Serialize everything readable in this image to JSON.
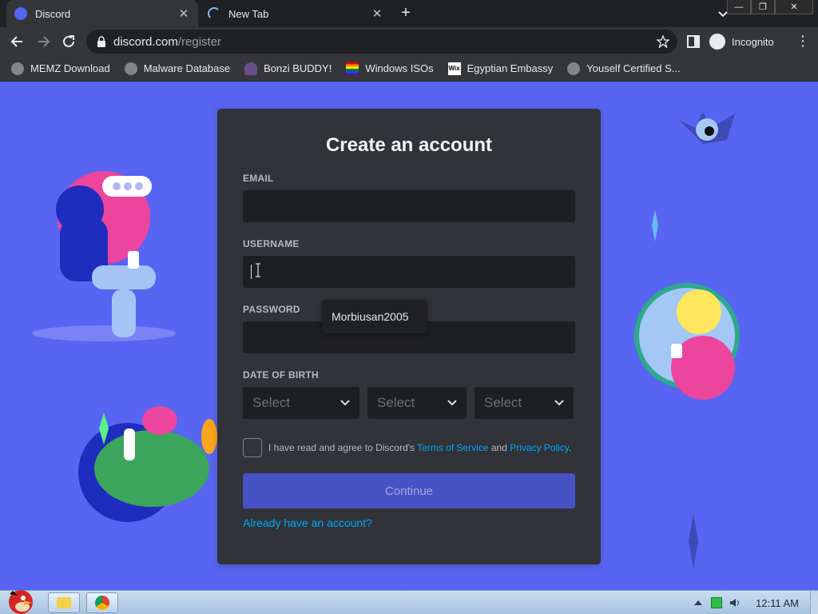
{
  "browser": {
    "tabs": [
      {
        "title": "Discord",
        "active": true
      },
      {
        "title": "New Tab",
        "active": false
      }
    ],
    "url_host": "discord.com",
    "url_path": "/register",
    "profile_label": "Incognito",
    "bookmarks": [
      {
        "label": "MEMZ Download",
        "icon": "globe-icon"
      },
      {
        "label": "Malware Database",
        "icon": "globe-icon"
      },
      {
        "label": "Bonzi BUDDY!",
        "icon": "bonzi-icon"
      },
      {
        "label": "Windows ISOs",
        "icon": "rainbow-flag-icon"
      },
      {
        "label": "Egyptian Embassy",
        "icon": "wix-icon"
      },
      {
        "label": "Youself Certified S...",
        "icon": "globe-icon"
      }
    ]
  },
  "form": {
    "title": "Create an account",
    "email_label": "EMAIL",
    "username_label": "USERNAME",
    "password_label": "PASSWORD",
    "dob_label": "DATE OF BIRTH",
    "dob_selects": [
      "Select",
      "Select",
      "Select"
    ],
    "agree_prefix": "I have read and agree to Discord's ",
    "tos_link": "Terms of Service",
    "agree_and": " and ",
    "privacy_link": "Privacy Policy",
    "agree_suffix": ".",
    "continue_label": "Continue",
    "login_link": "Already have an account?",
    "autocomplete_suggestion": "Morbiusan2005"
  },
  "taskbar": {
    "clock": "12:11 AM"
  },
  "colors": {
    "page_bg": "#5865f2",
    "card_bg": "#313338",
    "input_bg": "#1e1f22",
    "link": "#00a8fc",
    "button": "#4752c4"
  }
}
